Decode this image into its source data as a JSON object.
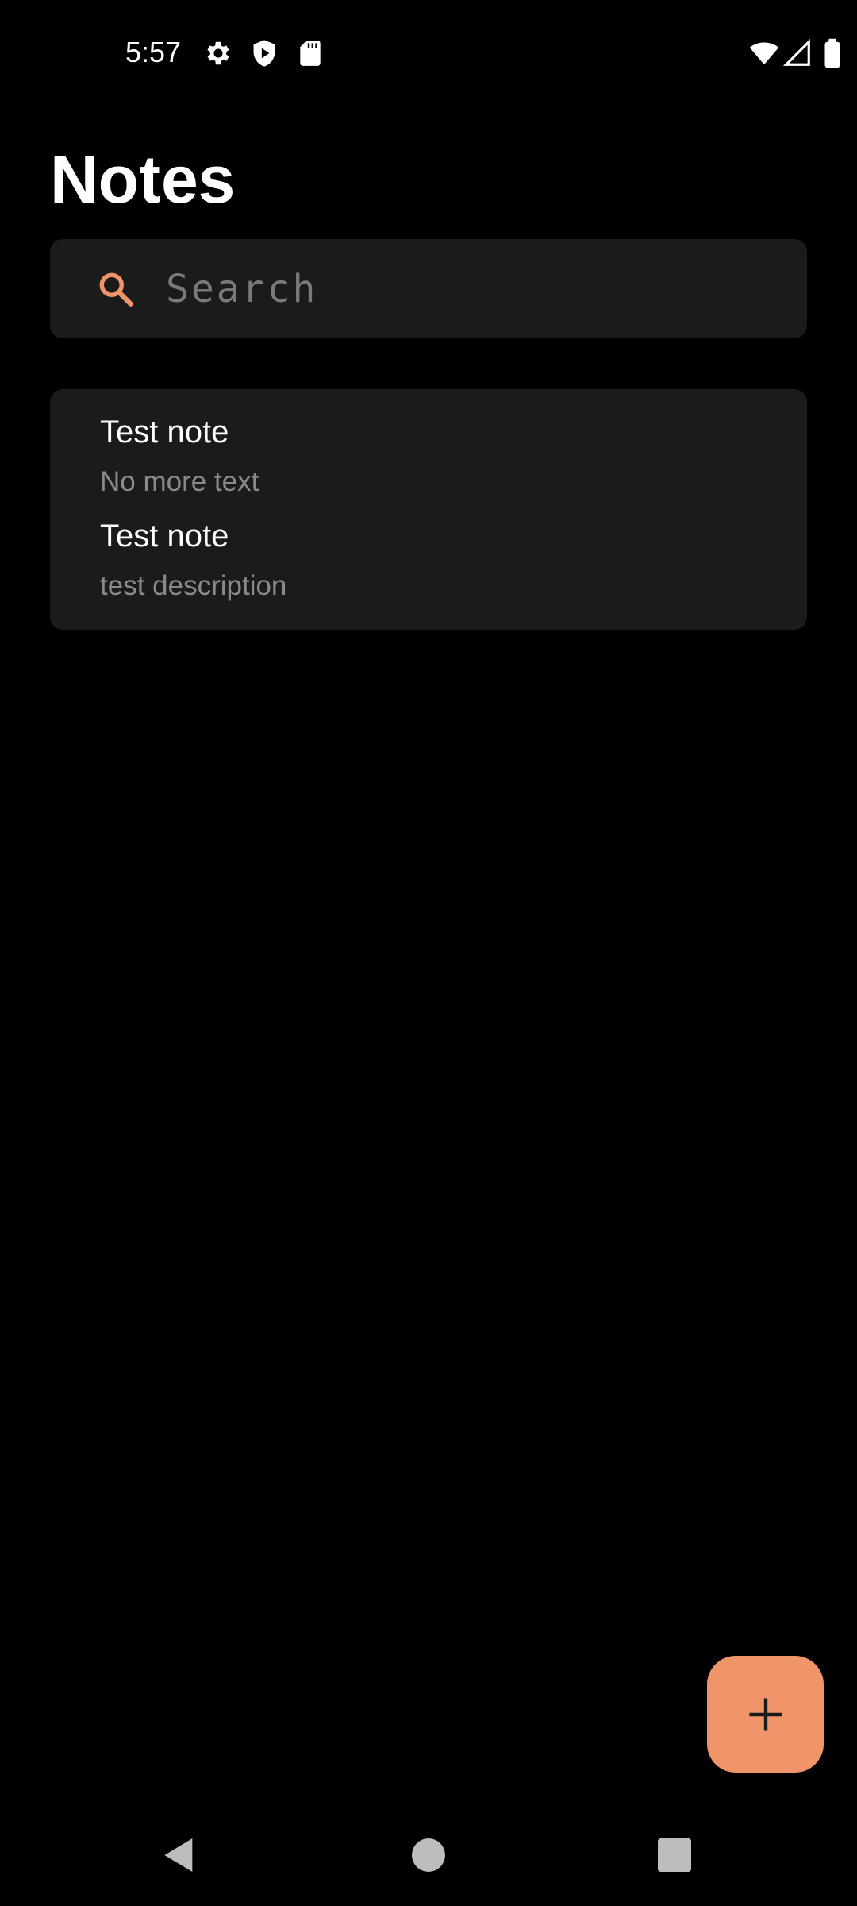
{
  "status_bar": {
    "time": "5:57",
    "left_icons": [
      "gear-icon",
      "shield-play-icon",
      "sd-card-icon"
    ],
    "right_icons": [
      "wifi-icon",
      "cell-signal-icon",
      "battery-icon"
    ]
  },
  "header": {
    "title": "Notes"
  },
  "search": {
    "placeholder": "Search",
    "value": "",
    "icon": "search-icon"
  },
  "notes": [
    {
      "title": "Test note",
      "description": "No more text"
    },
    {
      "title": "Test note",
      "description": "test description"
    }
  ],
  "fab": {
    "icon": "plus-icon"
  },
  "nav_bar": {
    "buttons": [
      "back-icon",
      "home-icon",
      "recents-icon"
    ]
  },
  "colors": {
    "background": "#000000",
    "surface": "#1b1b1b",
    "accent": "#f0956a",
    "text_primary": "#ffffff",
    "text_secondary": "#8a8a8a"
  }
}
